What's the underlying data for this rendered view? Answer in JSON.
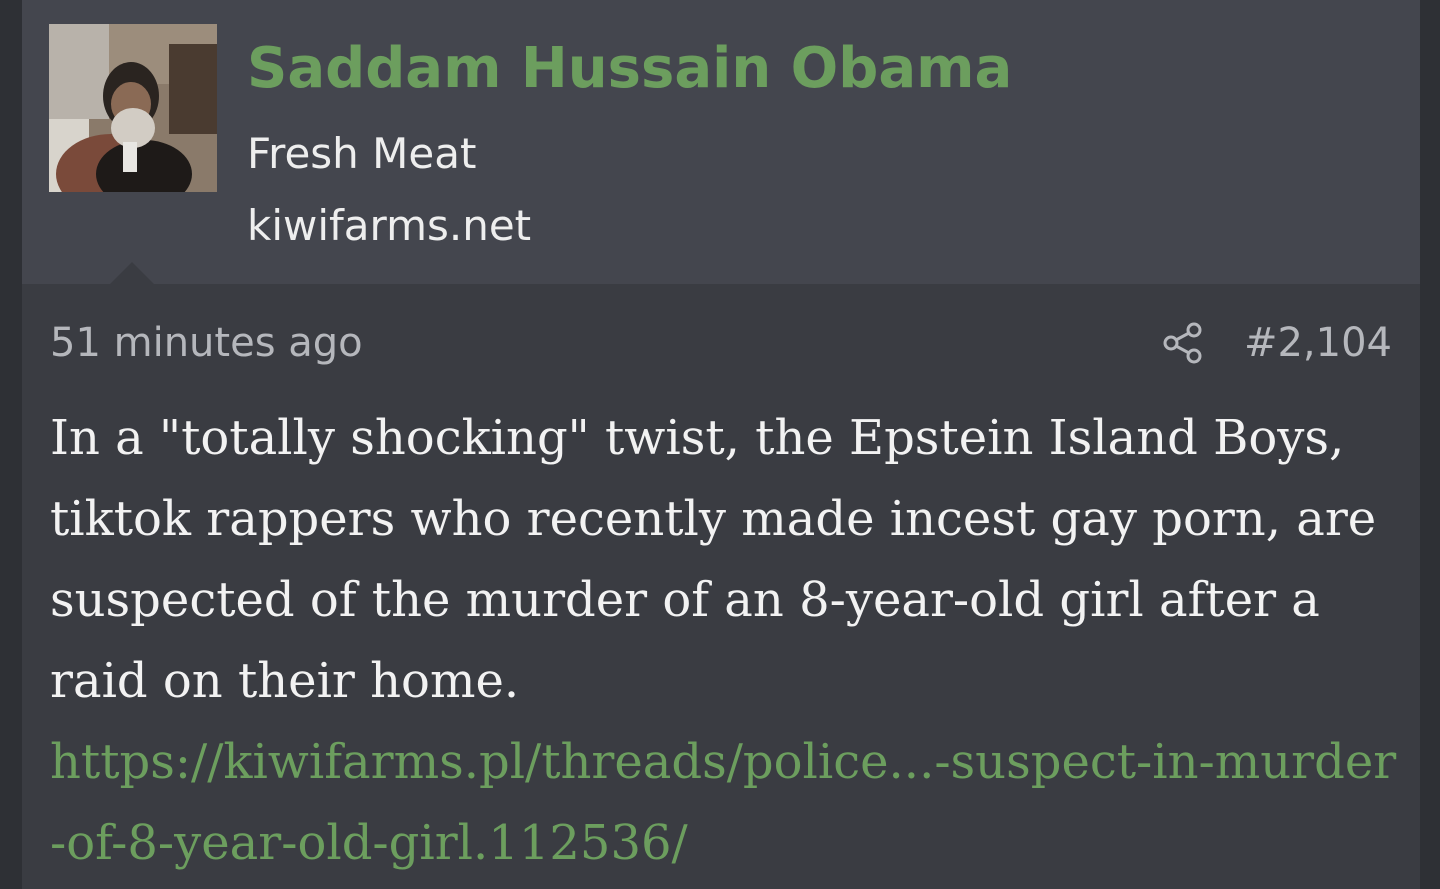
{
  "user": {
    "name": "Saddam Hussain Obama",
    "title": "Fresh Meat",
    "site": "kiwifarms.net"
  },
  "post": {
    "timestamp": "51 minutes ago",
    "number": "#2,104",
    "share_icon": "share-icon",
    "text": "In a \"totally shocking\" twist, the Epstein Island Boys, tiktok rappers who recently made incest gay porn, are suspected of the murder of an 8-year-old girl after a raid on their home.",
    "link": "https://kiwifarms.pl/threads/police...-suspect-in-murder-of-8-year-old-girl.112536/"
  },
  "colors": {
    "background": "#2e3035",
    "header": "#44464e",
    "post": "#3a3c42",
    "accent": "#6c9e5e",
    "text": "#f2f2f2",
    "muted": "#b5b7bc"
  }
}
